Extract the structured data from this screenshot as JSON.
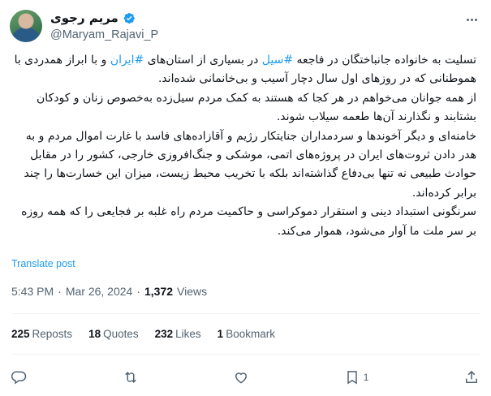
{
  "author": {
    "display_name": "مریم رجوی",
    "handle": "@Maryam_Rajavi_P",
    "verified_icon": "verified-badge-icon",
    "avatar": "profile-avatar"
  },
  "body": {
    "paragraphs": [
      {
        "segments": [
          {
            "text": "تسلیت به خانواده جانباختگان در فاجعه ",
            "tag": false
          },
          {
            "text": "#سیل",
            "tag": true
          },
          {
            "text": " در بسیاری از استان‌های ",
            "tag": false
          },
          {
            "text": "#ایران",
            "tag": true
          },
          {
            "text": " و با ابراز همدردی با هموطنانی که در روزهای اول سال دچار آسیب و بی‌خانمانی شده‌اند.",
            "tag": false
          }
        ]
      },
      {
        "segments": [
          {
            "text": "از همه جوانان می‌خواهم در هر کجا که هستند به کمک مردم سیل‌زده به‌خصوص زنان و کودکان بشتابند و نگذارند آن‌ها طعمه سیلاب شوند.",
            "tag": false
          }
        ]
      },
      {
        "segments": [
          {
            "text": "خامنه‌ای و دیگر آخوندها و سردمداران جنایتکار رژیم و آقازاده‌های فاسد با غارت اموال مردم و به هدر دادن ثروت‌های ایران در پروژه‌های اتمی، موشکی و جنگ‌افروزی خارجی، کشور را در مقابل حوادث طبیعی نه تنها بی‌دفاع گذاشته‌اند بلکه با تخریب محیط زیست، میزان این خسارت‌ها را چند برابر کرده‌اند.",
            "tag": false
          }
        ]
      },
      {
        "segments": [
          {
            "text": "سرنگونی استبداد دینی و استقرار دموکراسی و حاکمیت مردم راه غلبه بر فجایعی را که همه روزه بر سر ملت ما آوار می‌شود، هموار می‌کند.",
            "tag": false
          }
        ]
      }
    ]
  },
  "translate_label": "Translate post",
  "meta": {
    "time": "5:43 PM",
    "separator": "·",
    "date": "Mar 26, 2024",
    "views_count": "1,372",
    "views_label": "Views"
  },
  "stats": {
    "reposts": {
      "count": "225",
      "label": "Reposts"
    },
    "quotes": {
      "count": "18",
      "label": "Quotes"
    },
    "likes": {
      "count": "232",
      "label": "Likes"
    },
    "bookmarks": {
      "count": "1",
      "label": "Bookmark"
    }
  },
  "actions": {
    "reply_icon": "reply-icon",
    "repost_icon": "repost-icon",
    "like_icon": "like-icon",
    "bookmark_icon": "bookmark-icon",
    "bookmark_count": "1",
    "share_icon": "share-icon"
  },
  "colors": {
    "accent": "#1d9bf0",
    "text": "#0f1419",
    "secondary": "#536471",
    "divider": "#eff3f4"
  }
}
